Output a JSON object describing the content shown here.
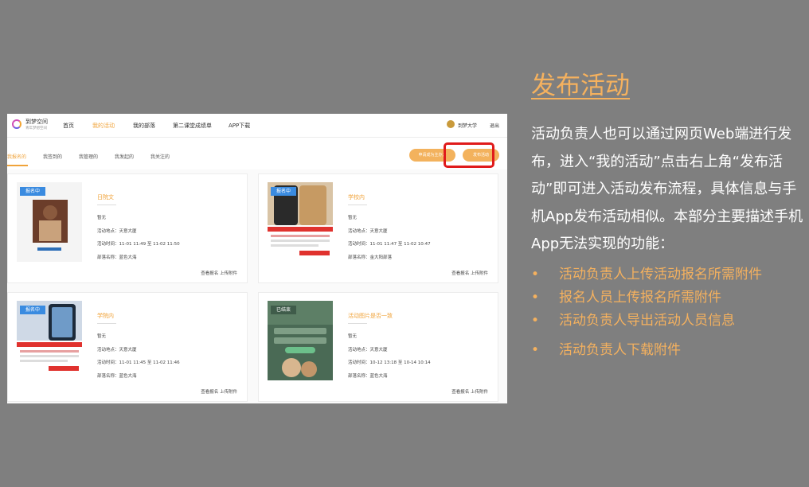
{
  "slide": {
    "title": "发布活动",
    "paragraph": "活动负责人也可以通过网页Web端进行发布，进入“我的活动”点击右上角“发布活动”即可进入活动发布流程，具体信息与手机App发布活动相似。本部分主要描述手机App无法实现的功能：",
    "bullets": [
      "活动负责人上传活动报名所需附件",
      "报名人员上传报名所需附件",
      "活动负责人导出活动人员信息",
      "活动负责人下载附件"
    ],
    "bullet_symbol": "•",
    "colors": {
      "background": "#7f7f7f",
      "accent": "#f5b15e",
      "highlight_box": "#e01b1b",
      "badge": "#3a8be0"
    }
  },
  "app": {
    "logo": {
      "name": "到梦空间",
      "tagline": "青年梦想空间"
    },
    "nav": [
      "首页",
      "我的活动",
      "我的部落",
      "第二课堂成绩单",
      "APP下载"
    ],
    "nav_active": "我的活动",
    "user": {
      "name": "到梦大学",
      "logout": "退出"
    },
    "subnav": [
      "我报名的",
      "我签到的",
      "我管理的",
      "我发起的",
      "我关注的"
    ],
    "subnav_active": "我报名的",
    "buttons": {
      "apply": "申请成为主办方",
      "publish": "发布活动"
    },
    "cards": [
      {
        "badge": "报名中",
        "title": "日院文",
        "desc": "暂无",
        "location": "活动地点：天意大厦",
        "time": "活动时间：11-01 11:49 至 11-02 11:50",
        "tribe": "部落名称：蓝色大海",
        "links": "查看报名 上传附件"
      },
      {
        "badge": "报名中",
        "title": "学校内",
        "desc": "暂无",
        "location": "活动地点：天意大厦",
        "time": "活动时间：11-01 11:47 至 11-02 10:47",
        "tribe": "部落名称：金大阳部落",
        "links": "查看报名 上传附件"
      },
      {
        "badge": "报名中",
        "title": "学院内",
        "desc": "暂无",
        "location": "活动地点：天意大厦",
        "time": "活动时间：11-01 11:45 至 11-02 11:46",
        "tribe": "部落名称：蓝色大海",
        "links": "查看报名 上传附件"
      },
      {
        "badge": "已结束",
        "title": "活动图片是否一致",
        "desc": "暂无",
        "location": "活动地点：天意大厦",
        "time": "活动时间：10-12 13:18 至 10-14 10:14",
        "tribe": "部落名称：蓝色大海",
        "links": "查看报名 上传附件"
      }
    ]
  }
}
